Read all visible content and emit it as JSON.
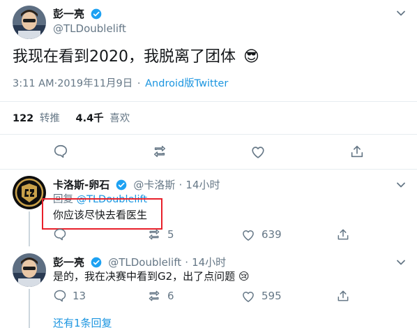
{
  "main_tweet": {
    "author_name": "彭一亮",
    "author_handle": "@TLDoublelift",
    "text": "我现在看到2020，我脱离了团体",
    "emoji": "😎",
    "timestamp": "3:11 AM·2019年11月9日",
    "source": "Android版Twitter",
    "retweets_count": "122",
    "retweets_label": "转推",
    "likes_count": "4.4千",
    "likes_label": "喜欢"
  },
  "reply1": {
    "author_name": "卡洛斯-卵石",
    "author_handle": "@卡洛斯",
    "time": "14小时",
    "replying_to_prefix": "回复",
    "replying_to_handle": "@TLDoublelift",
    "text": "你应该尽快去看医生",
    "retweet_count": "5",
    "like_count": "639",
    "highlight_color": "#e8202a"
  },
  "reply2": {
    "author_name": "彭一亮",
    "author_handle": "@TLDoublelift",
    "time": "14小时",
    "text": "是的，我在决赛中看到G2，出了点问题",
    "emoji": "😢",
    "reply_count": "13",
    "retweet_count": "6",
    "like_count": "595",
    "more_replies": "还有1条回复"
  },
  "colors": {
    "accent": "#1b95e0",
    "verified": "#1da1f2",
    "muted": "#657786",
    "divider": "#e6ecf0"
  }
}
